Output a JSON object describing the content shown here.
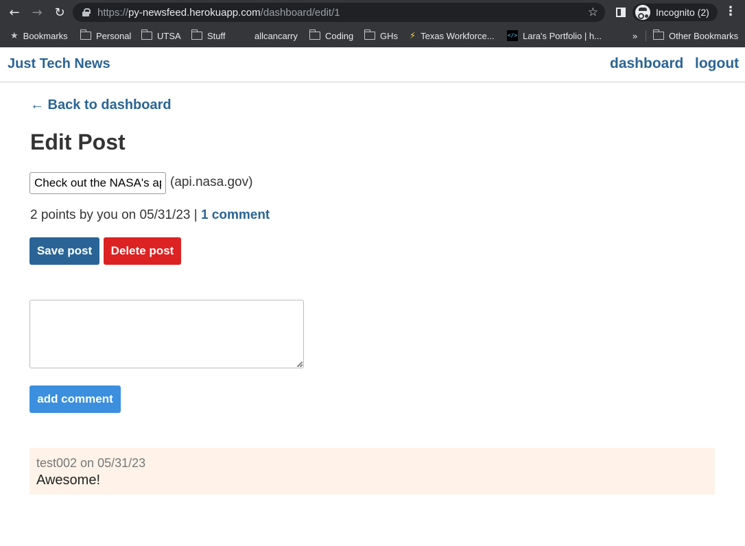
{
  "browser": {
    "url_scheme": "https://",
    "url_host": "py-newsfeed.herokuapp.com",
    "url_path": "/dashboard/edit/1",
    "profile_label": "Incognito (2)",
    "bookmarks": [
      {
        "label": "Bookmarks",
        "icon": "star-icon"
      },
      {
        "label": "Personal",
        "icon": "folder-icon"
      },
      {
        "label": "UTSA",
        "icon": "folder-icon"
      },
      {
        "label": "Stuff",
        "icon": "folder-icon"
      },
      {
        "label": "allcancarry",
        "icon": "none"
      },
      {
        "label": "Coding",
        "icon": "folder-icon"
      },
      {
        "label": "GHs",
        "icon": "folder-icon"
      },
      {
        "label": "Texas Workforce...",
        "icon": "lightning-icon"
      },
      {
        "label": "Lara's Portfolio | h...",
        "icon": "code-icon"
      }
    ],
    "overflow_label": "»",
    "other_bookmarks": "Other Bookmarks"
  },
  "header": {
    "brand": "Just Tech News",
    "nav": {
      "dashboard": "dashboard",
      "logout": "logout"
    }
  },
  "page": {
    "back_link": "← Back to dashboard",
    "title": "Edit Post",
    "post_title_value": "Check out the NASA's api!",
    "domain": "(api.nasa.gov)",
    "meta_prefix": "2 points by you on 05/31/23 |",
    "comment_count_link": "1 comment",
    "save_button": "Save post",
    "delete_button": "Delete post",
    "comment_placeholder": "",
    "add_comment_button": "add comment"
  },
  "comments": [
    {
      "meta": "test002 on 05/31/23",
      "text": "Awesome!"
    }
  ],
  "colors": {
    "link": "#2a6496",
    "delete": "#dc2222",
    "add_comment": "#3b8fde",
    "comment_bg": "#fff3e9"
  }
}
